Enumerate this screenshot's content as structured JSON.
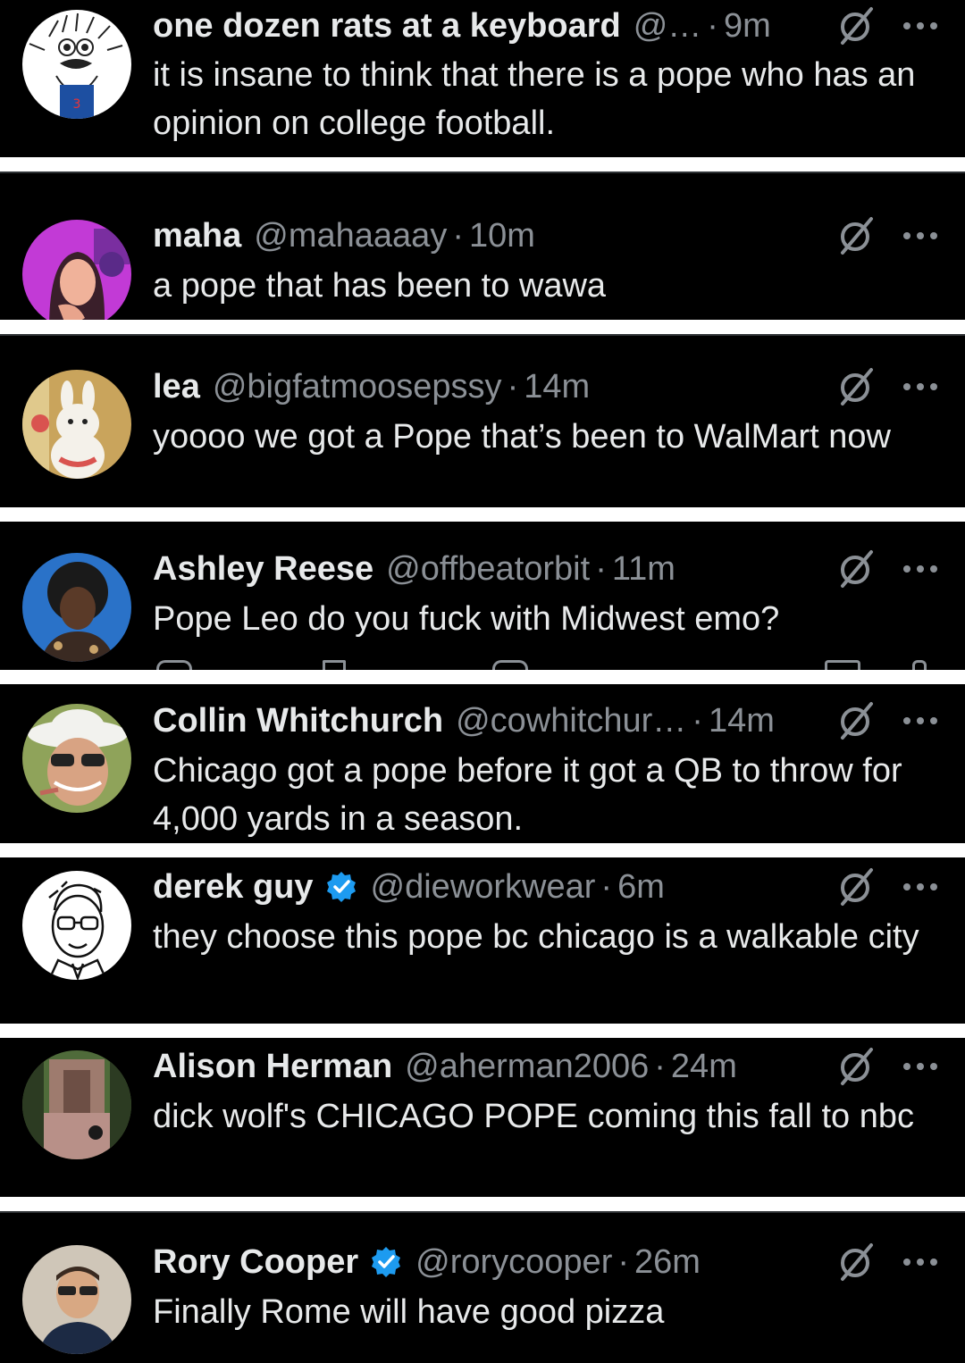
{
  "tweets": [
    {
      "name": "one dozen rats at a keyboard",
      "handle": "@…",
      "sep": "·",
      "time": "9m",
      "verified": false,
      "text": "it is insane to think that there is a pope who has an opinion on college football.",
      "avatar_colors": {
        "bg": "#ffffff",
        "fg": "#222222",
        "accent": "#1d4fa1"
      }
    },
    {
      "name": "maha",
      "handle": "@mahaaaay",
      "sep": "·",
      "time": "10m",
      "verified": false,
      "text": "a pope that has been to wawa",
      "avatar_colors": {
        "bg": "#c23ad6",
        "fg": "#f0b29a",
        "accent": "#3a1f2a"
      }
    },
    {
      "name": "lea",
      "handle": "@bigfatmoosepssy",
      "sep": "·",
      "time": "14m",
      "verified": false,
      "text": "yoooo we got a Pope that’s been to WalMart now",
      "avatar_colors": {
        "bg": "#c9a45c",
        "fg": "#f4f1ea",
        "accent": "#d9534f"
      }
    },
    {
      "name": "Ashley Reese",
      "handle": "@offbeatorbit",
      "sep": "·",
      "time": "11m",
      "verified": false,
      "text": "Pope Leo do you fuck with Midwest emo?",
      "avatar_colors": {
        "bg": "#2a72c8",
        "fg": "#5a3a28",
        "accent": "#1a1a1a"
      }
    },
    {
      "name": "Collin Whitchurch",
      "handle": "@cowhitchur…",
      "sep": "·",
      "time": "14m",
      "verified": false,
      "text": "Chicago got a pope before it got a QB to throw for 4,000 yards in a season.",
      "avatar_colors": {
        "bg": "#8fa35a",
        "fg": "#f2f2ee",
        "accent": "#c0665a"
      }
    },
    {
      "name": "derek guy",
      "handle": "@dieworkwear",
      "sep": "·",
      "time": "6m",
      "verified": true,
      "text": "they choose this pope bc chicago is a walkable city",
      "avatar_colors": {
        "bg": "#ffffff",
        "fg": "#111111",
        "accent": "#777777"
      }
    },
    {
      "name": "Alison Herman",
      "handle": "@aherman2006",
      "sep": "·",
      "time": "24m",
      "verified": false,
      "text": "dick wolf's CHICAGO POPE coming this fall to nbc",
      "avatar_colors": {
        "bg": "#4f6b3a",
        "fg": "#b89088",
        "accent": "#2c3b22"
      }
    },
    {
      "name": "Rory Cooper",
      "handle": "@rorycooper",
      "sep": "·",
      "time": "26m",
      "verified": true,
      "text": "Finally Rome will have good pizza",
      "avatar_colors": {
        "bg": "#cfc6b8",
        "fg": "#1c2a44",
        "accent": "#d8a883"
      }
    }
  ],
  "colors": {
    "background": "#000000",
    "separator": "#ffffff",
    "text": "#e7e9ea",
    "muted": "#8b9096",
    "verified": "#1d9bf0"
  }
}
